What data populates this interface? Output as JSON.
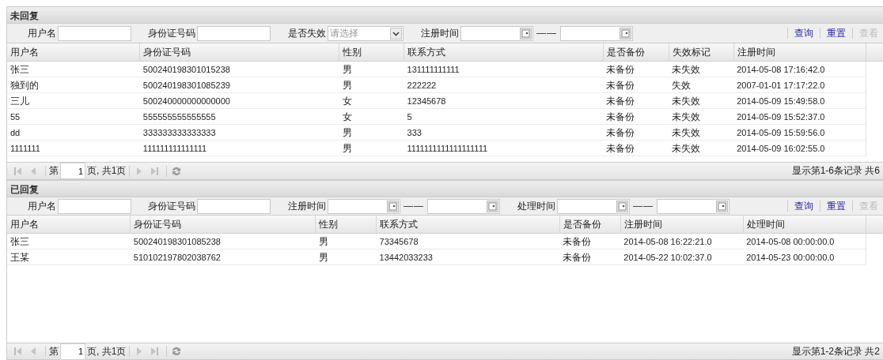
{
  "panels": [
    {
      "title": "未回复",
      "filters": [
        {
          "kind": "text",
          "label": "用户名"
        },
        {
          "kind": "text",
          "label": "身份证号码"
        },
        {
          "kind": "select",
          "label": "是否失效",
          "placeholder": "请选择"
        },
        {
          "kind": "daterange",
          "label": "注册时间",
          "separator": "——"
        }
      ],
      "actions": [
        {
          "label": "查询",
          "disabled": false
        },
        {
          "label": "重置",
          "disabled": false
        },
        {
          "label": "查看",
          "disabled": true
        }
      ],
      "columns": [
        "用户名",
        "身份证号码",
        "性别",
        "联系方式",
        "是否备份",
        "失效标记",
        "注册时间"
      ],
      "rows": [
        [
          "张三",
          "500240198301015238",
          "男",
          "131111111111",
          "未备份",
          "未失效",
          "2014-05-08 17:16:42.0"
        ],
        [
          "独到的",
          "500240198301085239",
          "男",
          "222222",
          "未备份",
          "失效",
          "2007-01-01 17:17:22.0"
        ],
        [
          "三儿",
          "500240000000000000",
          "女",
          "12345678",
          "未备份",
          "未失效",
          "2014-05-09 15:49:58.0"
        ],
        [
          "55",
          "555555555555555",
          "女",
          "5",
          "未备份",
          "未失效",
          "2014-05-09 15:52:37.0"
        ],
        [
          "dd",
          "333333333333333",
          "男",
          "333",
          "未备份",
          "未失效",
          "2014-05-09 15:59:56.0"
        ],
        [
          "1111111",
          "111111111111111",
          "男",
          "1111111111111111111",
          "未备份",
          "未失效",
          "2014-05-09 16:02:55.0"
        ]
      ],
      "pager": {
        "before": "第",
        "page": "1",
        "after": "页, 共1页",
        "summary": "显示第1-6条记录 共6"
      }
    },
    {
      "title": "已回复",
      "filters": [
        {
          "kind": "text",
          "label": "用户名"
        },
        {
          "kind": "text",
          "label": "身份证号码"
        },
        {
          "kind": "daterange",
          "label": "注册时间",
          "separator": "——"
        },
        {
          "kind": "daterange",
          "label": "处理时间",
          "separator": "——"
        }
      ],
      "actions": [
        {
          "label": "查询",
          "disabled": false
        },
        {
          "label": "重置",
          "disabled": false
        },
        {
          "label": "查看",
          "disabled": true
        }
      ],
      "columns": [
        "用户名",
        "身份证号码",
        "性别",
        "联系方式",
        "是否备份",
        "注册时间",
        "处理时间"
      ],
      "rows": [
        [
          "张三",
          "500240198301085238",
          "男",
          "73345678",
          "未备份",
          "2014-05-08 16:22:21.0",
          "2014-05-08 00:00:00.0"
        ],
        [
          "王某",
          "510102197802038762",
          "男",
          "13442033233",
          "未备份",
          "2014-05-22 10:02:37.0",
          "2014-05-23 00:00:00.0"
        ]
      ],
      "pager": {
        "before": "第",
        "page": "1",
        "after": "页, 共1页",
        "summary": "显示第1-2条记录 共2"
      }
    }
  ]
}
